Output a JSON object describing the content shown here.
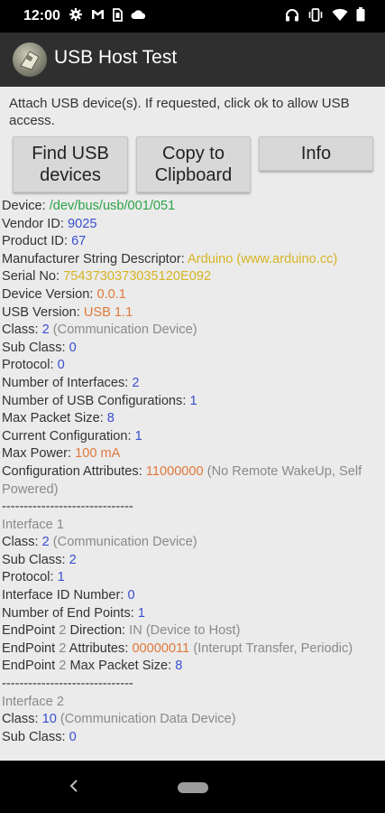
{
  "status_bar": {
    "time": "12:00"
  },
  "app_bar": {
    "title": "USB Host Test"
  },
  "intro_text": "Attach USB device(s).  If requested, click ok to allow USB access.",
  "buttons": {
    "find_usb": "Find USB devices",
    "copy": "Copy to Clipboard",
    "info": "Info"
  },
  "device": {
    "device_label": "Device: ",
    "device_value": "/dev/bus/usb/001/051",
    "vendor_label": "Vendor ID: ",
    "vendor_value": "9025",
    "product_label": "Product ID: ",
    "product_value": "67",
    "manufacturer_label": "Manufacturer String Descriptor: ",
    "manufacturer_value": "Arduino (www.arduino.cc)",
    "serial_label": "Serial No: ",
    "serial_value": "7543730373035120E092",
    "device_version_label": "Device Version: ",
    "device_version_value": "0.0.1",
    "usb_version_label": "USB Version: ",
    "usb_version_value": "USB 1.1",
    "class_label": "Class: ",
    "class_value": "2",
    "class_desc": " (Communication Device)",
    "subclass_label": "Sub Class: ",
    "subclass_value": "0",
    "protocol_label": "Protocol: ",
    "protocol_value": "0",
    "num_interfaces_label": "Number of Interfaces: ",
    "num_interfaces_value": "2",
    "num_configs_label": "Number of USB Configurations: ",
    "num_configs_value": "1",
    "max_packet_label": "Max Packet Size: ",
    "max_packet_value": "8",
    "current_config_label": "Current Configuration: ",
    "current_config_value": "1",
    "max_power_label": "Max Power: ",
    "max_power_value": "100 mA",
    "config_attr_label": "Configuration Attributes: ",
    "config_attr_value": "11000000",
    "config_attr_desc": " (No Remote WakeUp, Self Powered)",
    "separator": "------------------------------"
  },
  "interface1": {
    "title": "Interface 1",
    "class_label": "Class: ",
    "class_value": "2",
    "class_desc": " (Communication Device)",
    "subclass_label": "Sub Class: ",
    "subclass_value": "2",
    "protocol_label": "Protocol: ",
    "protocol_value": "1",
    "id_label": "Interface ID Number: ",
    "id_value": "0",
    "endpoints_label": "Number of End Points: ",
    "endpoints_value": "1",
    "ep_dir_label_a": "EndPoint ",
    "ep_dir_num": "2",
    "ep_dir_label_b": " Direction: ",
    "ep_dir_value": "IN (Device to Host)",
    "ep_attr_label_a": "EndPoint ",
    "ep_attr_num": "2",
    "ep_attr_label_b": " Attributes: ",
    "ep_attr_value": "00000011",
    "ep_attr_desc": " (Interupt Transfer, Periodic)",
    "ep_size_label_a": "EndPoint ",
    "ep_size_num": "2",
    "ep_size_label_b": " Max Packet Size: ",
    "ep_size_value": "8",
    "separator": "------------------------------"
  },
  "interface2": {
    "title": "Interface 2",
    "class_label": "Class: ",
    "class_value": "10",
    "class_desc": " (Communication Data Device)",
    "subclass_label": "Sub Class: ",
    "subclass_value": "0"
  },
  "icons": {
    "status_left": [
      "gear-notification-icon",
      "gmail-icon",
      "sim-icon",
      "cloud-icon"
    ],
    "status_right": [
      "headphones-icon",
      "vibrate-icon",
      "wifi-icon",
      "battery-icon"
    ],
    "nav": [
      "back-icon",
      "home-pill-icon"
    ]
  },
  "colors": {
    "status_bar": "#000000",
    "app_bar": "#2f2f2f",
    "background": "#ebebeb",
    "value_blue": "#3a4fd0",
    "value_green": "#2ea34a",
    "value_yellow": "#d6b423",
    "value_orange": "#e07a3c",
    "value_gray": "#8a8a8a"
  }
}
